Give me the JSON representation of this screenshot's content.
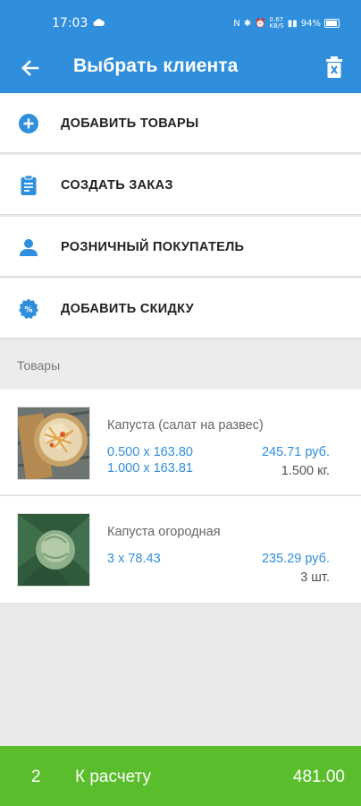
{
  "status_bar": {
    "time": "17:03",
    "net_speed": "0.67\nKB/S",
    "battery": "94%"
  },
  "app_bar": {
    "title": "Выбрать клиента",
    "back_icon": "arrow-left-icon",
    "delete_icon": "trash-icon"
  },
  "menu": [
    {
      "label": "ДОБАВИТЬ ТОВАРЫ",
      "icon": "add-circle-icon"
    },
    {
      "label": "СОЗДАТЬ ЗАКАЗ",
      "icon": "clipboard-icon"
    },
    {
      "label": "РОЗНИЧНЫЙ ПОКУПАТЕЛЬ",
      "icon": "person-icon"
    },
    {
      "label": "ДОБАВИТЬ СКИДКУ",
      "icon": "percent-badge-icon"
    }
  ],
  "section": {
    "title": "Товары"
  },
  "products": [
    {
      "name": "Капуста (салат на развес)",
      "line1": "0.500 x 163.80",
      "line2": "1.000 x 163.81",
      "price": "245.71 руб.",
      "quantity": "1.500 кг."
    },
    {
      "name": "Капуста огородная",
      "line1": "3 x 78.43",
      "line2": "",
      "price": "235.29 руб.",
      "quantity": "3 шт."
    }
  ],
  "footer": {
    "count": "2",
    "label": "К расчету",
    "total": "481.00"
  },
  "colors": {
    "primary": "#2f8fdc",
    "checkout": "#5abd2c"
  }
}
